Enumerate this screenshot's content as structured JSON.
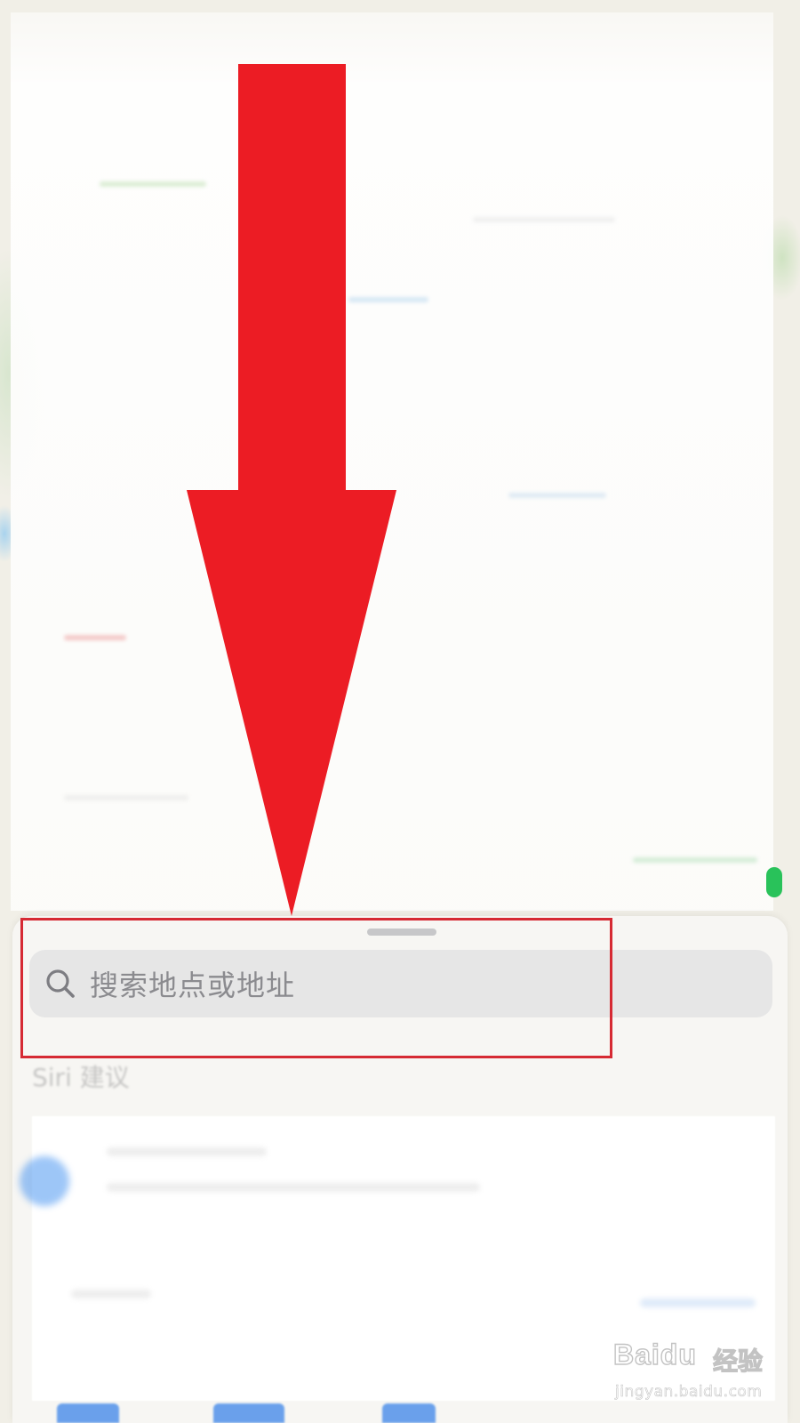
{
  "search": {
    "placeholder": "搜索地点或地址",
    "icon": "search-icon"
  },
  "suggestions": {
    "header": "Siri 建议"
  },
  "annotation": {
    "arrow_color": "#ec1c24",
    "highlight_color": "#d62a33"
  },
  "watermark": {
    "logo": "Baidu",
    "label": "经验",
    "url": "jingyan.baidu.com"
  },
  "colors": {
    "accent": "#2f7de8",
    "search_field_bg": "#e6e6e6"
  }
}
